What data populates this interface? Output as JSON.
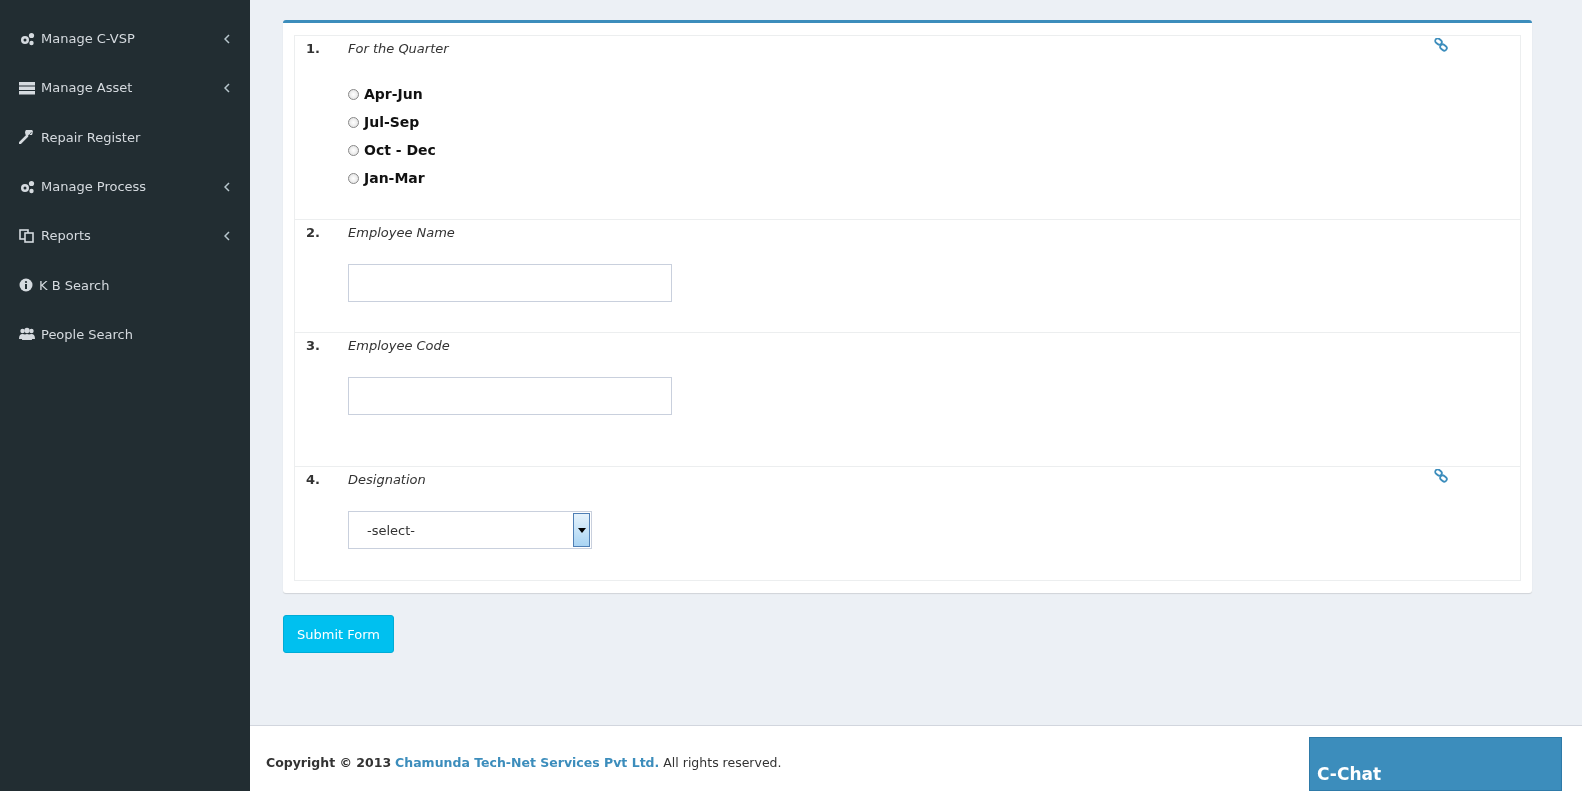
{
  "sidebar": {
    "items": [
      {
        "label": "Manage C-VSP",
        "expandable": true
      },
      {
        "label": "Manage Asset",
        "expandable": true
      },
      {
        "label": "Repair Register",
        "expandable": false
      },
      {
        "label": "Manage Process",
        "expandable": true
      },
      {
        "label": "Reports",
        "expandable": true
      },
      {
        "label": "K B Search",
        "expandable": false
      },
      {
        "label": "People Search",
        "expandable": false
      }
    ]
  },
  "form": {
    "questions": [
      {
        "number": "1.",
        "label": "For the Quarter",
        "kind": "radio",
        "has_link": true,
        "options": [
          {
            "label": "Apr-Jun",
            "selected": false
          },
          {
            "label": "Jul-Sep",
            "selected": false
          },
          {
            "label": "Oct - Dec",
            "selected": false
          },
          {
            "label": "Jan-Mar",
            "selected": false
          }
        ]
      },
      {
        "number": "2.",
        "label": "Employee Name",
        "kind": "text",
        "has_link": false
      },
      {
        "number": "3.",
        "label": "Employee Code",
        "kind": "text",
        "has_link": false
      },
      {
        "number": "4.",
        "label": "Designation",
        "kind": "select",
        "has_link": true,
        "value": "-select-"
      }
    ],
    "submit": "Submit Form"
  },
  "footer": {
    "prefix": "Copyright © 2013",
    "company": "Chamunda Tech-Net Services Pvt Ltd.",
    "suffix": "All rights reserved."
  },
  "chat": {
    "title": "C-Chat"
  }
}
